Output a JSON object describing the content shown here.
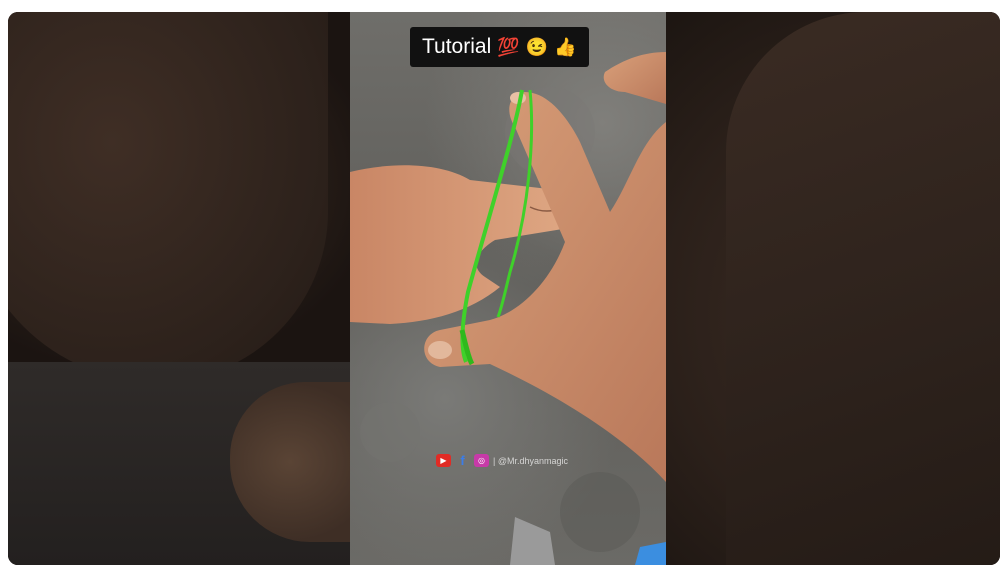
{
  "video": {
    "title": "Tutorial",
    "title_emojis": [
      "💯",
      "😉",
      "👍"
    ],
    "watermark": {
      "icons": [
        "youtube-icon",
        "facebook-icon",
        "instagram-icon"
      ],
      "handle": "| @Mr.dhyanmagic"
    }
  },
  "colors": {
    "rubber_band": "#3fd12a",
    "skin": "#c88a64",
    "title_bg": "#111111"
  }
}
